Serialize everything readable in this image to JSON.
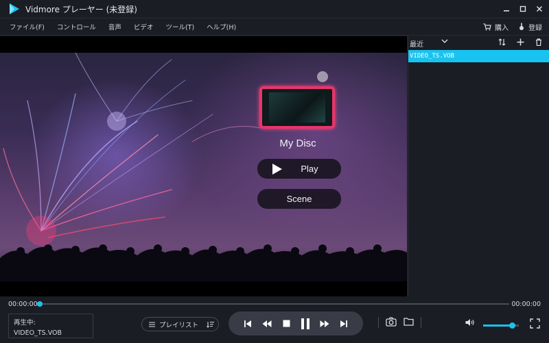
{
  "app": {
    "title": "Vidmore プレーヤー (未登録)",
    "accent_color": "#19c3f0"
  },
  "window_controls": [
    "minimize-icon",
    "maximize-icon",
    "close-icon"
  ],
  "menu": {
    "items": [
      "ファイル(F)",
      "コントロール",
      "音声",
      "ビデオ",
      "ツール(T)",
      "ヘルプ(H)"
    ],
    "purchase_label": "購入",
    "register_label": "登録"
  },
  "disc_menu": {
    "title": "My Disc",
    "play_label": "Play",
    "scene_label": "Scene"
  },
  "playlist_panel": {
    "sort_label": "最近",
    "items": [
      {
        "name": "VIDEO_TS.VOB",
        "selected": true
      }
    ]
  },
  "playback": {
    "current_time": "00:00:00",
    "total_time": "00:00:00",
    "progress": 0,
    "now_playing_label": "再生中:",
    "now_playing_file": "VIDEO_TS.VOB",
    "playlist_button_label": "プレイリスト",
    "volume": 0.8
  }
}
